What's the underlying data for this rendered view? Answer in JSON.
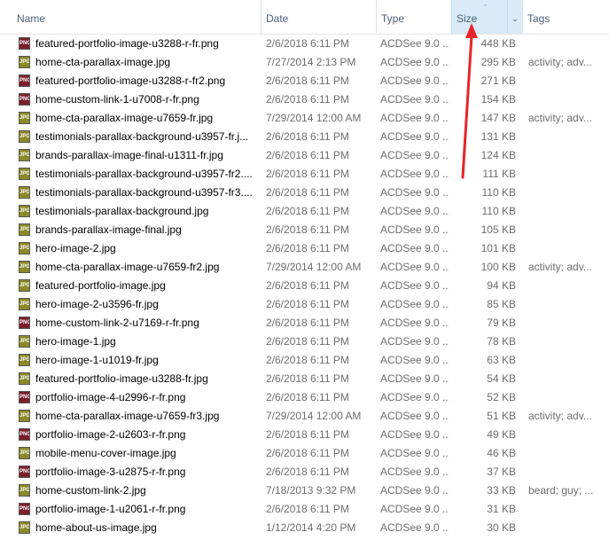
{
  "header": {
    "name": "Name",
    "date": "Date",
    "type": "Type",
    "size": "Size",
    "tags": "Tags",
    "sort_indicator": "ˇ",
    "dropdown": "⌄"
  },
  "files": [
    {
      "name": "featured-portfolio-image-u3288-r-fr.png",
      "ext": "png",
      "date": "2/6/2018 6:11 PM",
      "type": "ACDSee 9.0 ...",
      "size": "448 KB",
      "tags": ""
    },
    {
      "name": "home-cta-parallax-image.jpg",
      "ext": "jpg",
      "date": "7/27/2014 2:13 PM",
      "type": "ACDSee 9.0 ...",
      "size": "295 KB",
      "tags": "activity; adv..."
    },
    {
      "name": "featured-portfolio-image-u3288-r-fr2.png",
      "ext": "png",
      "date": "2/6/2018 6:11 PM",
      "type": "ACDSee 9.0 ...",
      "size": "271 KB",
      "tags": ""
    },
    {
      "name": "home-custom-link-1-u7008-r-fr.png",
      "ext": "png",
      "date": "2/6/2018 6:11 PM",
      "type": "ACDSee 9.0 ...",
      "size": "154 KB",
      "tags": ""
    },
    {
      "name": "home-cta-parallax-image-u7659-fr.jpg",
      "ext": "jpg",
      "date": "7/29/2014 12:00 AM",
      "type": "ACDSee 9.0 ...",
      "size": "147 KB",
      "tags": "activity; adv..."
    },
    {
      "name": "testimonials-parallax-background-u3957-fr.j...",
      "ext": "jpg",
      "date": "2/6/2018 6:11 PM",
      "type": "ACDSee 9.0 ...",
      "size": "131 KB",
      "tags": ""
    },
    {
      "name": "brands-parallax-image-final-u1311-fr.jpg",
      "ext": "jpg",
      "date": "2/6/2018 6:11 PM",
      "type": "ACDSee 9.0 ...",
      "size": "124 KB",
      "tags": ""
    },
    {
      "name": "testimonials-parallax-background-u3957-fr2....",
      "ext": "jpg",
      "date": "2/6/2018 6:11 PM",
      "type": "ACDSee 9.0 ...",
      "size": "111 KB",
      "tags": ""
    },
    {
      "name": "testimonials-parallax-background-u3957-fr3....",
      "ext": "jpg",
      "date": "2/6/2018 6:11 PM",
      "type": "ACDSee 9.0 ...",
      "size": "110 KB",
      "tags": ""
    },
    {
      "name": "testimonials-parallax-background.jpg",
      "ext": "jpg",
      "date": "2/6/2018 6:11 PM",
      "type": "ACDSee 9.0 ...",
      "size": "110 KB",
      "tags": ""
    },
    {
      "name": "brands-parallax-image-final.jpg",
      "ext": "jpg",
      "date": "2/6/2018 6:11 PM",
      "type": "ACDSee 9.0 ...",
      "size": "105 KB",
      "tags": ""
    },
    {
      "name": "hero-image-2.jpg",
      "ext": "jpg",
      "date": "2/6/2018 6:11 PM",
      "type": "ACDSee 9.0 ...",
      "size": "101 KB",
      "tags": ""
    },
    {
      "name": "home-cta-parallax-image-u7659-fr2.jpg",
      "ext": "jpg",
      "date": "7/29/2014 12:00 AM",
      "type": "ACDSee 9.0 ...",
      "size": "100 KB",
      "tags": "activity; adv..."
    },
    {
      "name": "featured-portfolio-image.jpg",
      "ext": "jpg",
      "date": "2/6/2018 6:11 PM",
      "type": "ACDSee 9.0 ...",
      "size": "94 KB",
      "tags": ""
    },
    {
      "name": "hero-image-2-u3596-fr.jpg",
      "ext": "jpg",
      "date": "2/6/2018 6:11 PM",
      "type": "ACDSee 9.0 ...",
      "size": "85 KB",
      "tags": ""
    },
    {
      "name": "home-custom-link-2-u7169-r-fr.png",
      "ext": "png",
      "date": "2/6/2018 6:11 PM",
      "type": "ACDSee 9.0 ...",
      "size": "79 KB",
      "tags": ""
    },
    {
      "name": "hero-image-1.jpg",
      "ext": "jpg",
      "date": "2/6/2018 6:11 PM",
      "type": "ACDSee 9.0 ...",
      "size": "78 KB",
      "tags": ""
    },
    {
      "name": "hero-image-1-u1019-fr.jpg",
      "ext": "jpg",
      "date": "2/6/2018 6:11 PM",
      "type": "ACDSee 9.0 ...",
      "size": "63 KB",
      "tags": ""
    },
    {
      "name": "featured-portfolio-image-u3288-fr.jpg",
      "ext": "jpg",
      "date": "2/6/2018 6:11 PM",
      "type": "ACDSee 9.0 ...",
      "size": "54 KB",
      "tags": ""
    },
    {
      "name": "portfolio-image-4-u2996-r-fr.png",
      "ext": "png",
      "date": "2/6/2018 6:11 PM",
      "type": "ACDSee 9.0 ...",
      "size": "52 KB",
      "tags": ""
    },
    {
      "name": "home-cta-parallax-image-u7659-fr3.jpg",
      "ext": "jpg",
      "date": "7/29/2014 12:00 AM",
      "type": "ACDSee 9.0 ...",
      "size": "51 KB",
      "tags": "activity; adv..."
    },
    {
      "name": "portfolio-image-2-u2603-r-fr.png",
      "ext": "png",
      "date": "2/6/2018 6:11 PM",
      "type": "ACDSee 9.0 ...",
      "size": "49 KB",
      "tags": ""
    },
    {
      "name": "mobile-menu-cover-image.jpg",
      "ext": "jpg",
      "date": "2/6/2018 6:11 PM",
      "type": "ACDSee 9.0 ...",
      "size": "46 KB",
      "tags": ""
    },
    {
      "name": "portfolio-image-3-u2875-r-fr.png",
      "ext": "png",
      "date": "2/6/2018 6:11 PM",
      "type": "ACDSee 9.0 ...",
      "size": "37 KB",
      "tags": ""
    },
    {
      "name": "home-custom-link-2.jpg",
      "ext": "jpg",
      "date": "7/18/2013 9:32 PM",
      "type": "ACDSee 9.0 ...",
      "size": "33 KB",
      "tags": "beard; guy; ..."
    },
    {
      "name": "portfolio-image-1-u2061-r-fr.png",
      "ext": "png",
      "date": "2/6/2018 6:11 PM",
      "type": "ACDSee 9.0 ...",
      "size": "31 KB",
      "tags": ""
    },
    {
      "name": "home-about-us-image.jpg",
      "ext": "jpg",
      "date": "1/12/2014 4:20 PM",
      "type": "ACDSee 9.0 ...",
      "size": "30 KB",
      "tags": ""
    }
  ],
  "icon_labels": {
    "png": "PNG",
    "jpg": "JPG"
  },
  "colors": {
    "size_column_highlight": "#d9ebf9",
    "annotation_arrow": "#e8232a",
    "png_icon": "#7b1f2a",
    "jpg_icon": "#8a8a28"
  }
}
